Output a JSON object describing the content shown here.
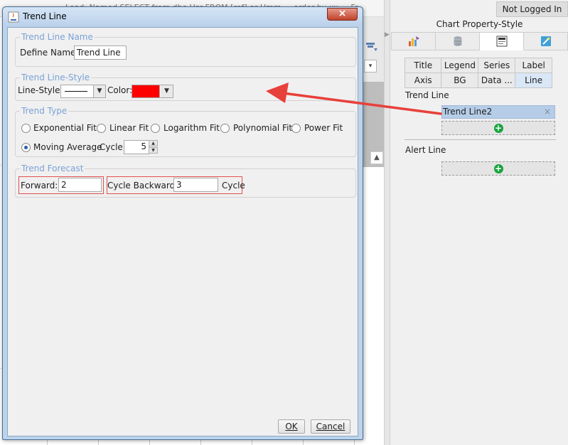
{
  "background": {
    "query_text": "Load: Named SELECT from dbo.Hsr FROM [ref] or Hmm ... order by xx ... Fr",
    "dropdown_glyph": "▾"
  },
  "status": {
    "login": "Not Logged In"
  },
  "right_panel": {
    "title": "Chart Property-Style",
    "tabs": [
      {
        "icon": "chart-type-icon"
      },
      {
        "icon": "database-icon"
      },
      {
        "icon": "style-label-icon"
      },
      {
        "icon": "magic-wand-icon"
      }
    ],
    "subtabs": [
      [
        "Title",
        "Legend",
        "Series",
        "Label"
      ],
      [
        "Axis",
        "BG",
        "Data ...",
        "Line"
      ]
    ],
    "active_subtab": "Line",
    "trend_line_label": "Trend Line",
    "trend_items": [
      "Trend Line2"
    ],
    "close_glyph": "×",
    "add_glyph": "+",
    "alert_line_label": "Alert Line"
  },
  "dialog": {
    "title": "Trend Line",
    "close_glyph": "×",
    "name_section": {
      "legend": "Trend Line Name",
      "define_name_label": "Define Name",
      "define_name_value": "Trend Line"
    },
    "style_section": {
      "legend": "Trend Line-Style",
      "line_style_label": "Line-Style:",
      "color_label": "Color:",
      "color_value": "#ff0000",
      "arrow_glyph": "▼"
    },
    "type_section": {
      "legend": "Trend Type",
      "options": [
        "Exponential Fit",
        "Linear Fit",
        "Logarithm Fit",
        "Polynomial Fit",
        "Power Fit"
      ],
      "moving_average_label": "Moving Average",
      "moving_average_selected": true,
      "cycle_label": "Cycle:",
      "cycle_value": "5",
      "spin_up": "▲",
      "spin_down": "▼"
    },
    "forecast_section": {
      "legend": "Trend Forecast",
      "forward_label": "Forward:",
      "forward_value": "2",
      "cycle_backward_label": "Cycle Backward:",
      "backward_value": "3",
      "cycle_suffix": "Cycle"
    },
    "ok_label": "OK",
    "cancel_label": "Cancel"
  }
}
